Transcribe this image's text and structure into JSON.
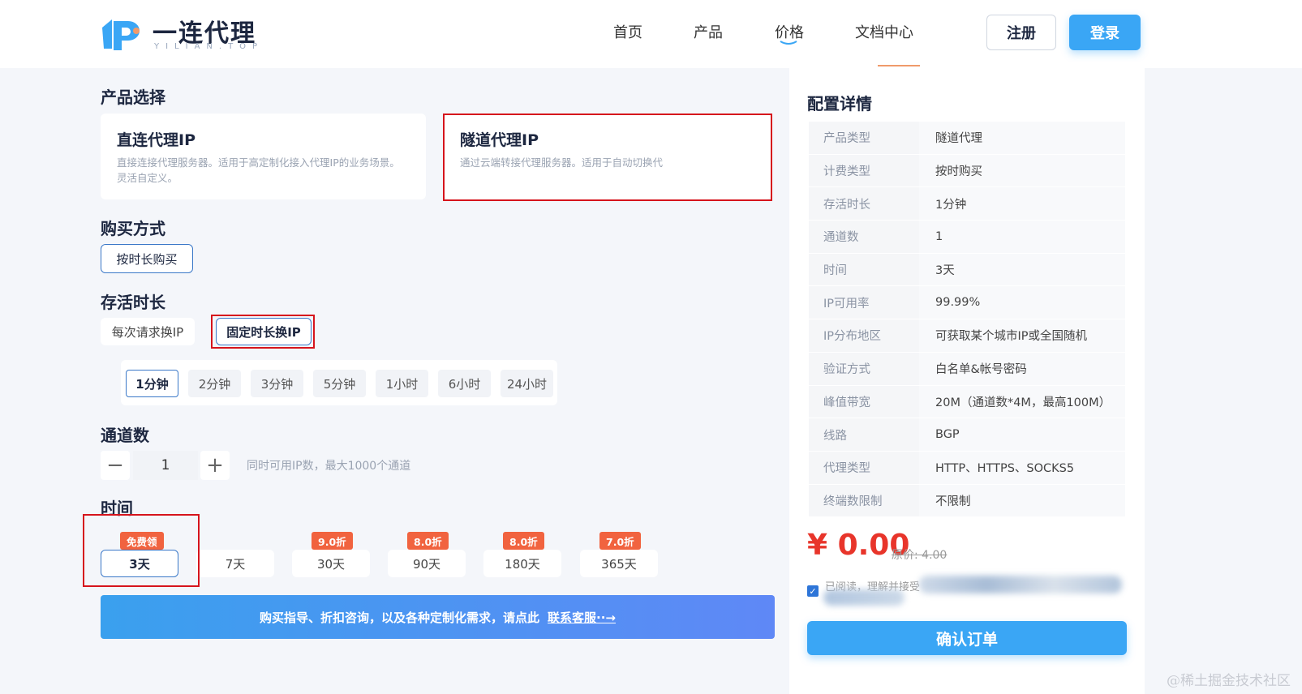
{
  "header": {
    "logo_text": "一连代理",
    "logo_sub": "YILIAN.TOP",
    "nav": [
      "首页",
      "产品",
      "价格",
      "文档中心"
    ],
    "register": "注册",
    "login": "登录"
  },
  "product": {
    "title": "产品选择",
    "cards": [
      {
        "name": "直连代理IP",
        "desc": "直接连接代理服务器。适用于高定制化接入代理IP的业务场景。灵活自定义。"
      },
      {
        "name": "隧道代理IP",
        "desc": "通过云端转接代理服务器。适用于自动切换代"
      }
    ]
  },
  "purchase": {
    "title": "购买方式",
    "option": "按时长购买"
  },
  "survival": {
    "title": "存活时长",
    "modes": [
      "每次请求换IP",
      "固定时长换IP"
    ],
    "durations": [
      "1分钟",
      "2分钟",
      "3分钟",
      "5分钟",
      "1小时",
      "6小时",
      "24小时"
    ]
  },
  "channels": {
    "title": "通道数",
    "minus": "−",
    "plus": "+",
    "value": "1",
    "hint": "同时可用IP数，最大1000个通道"
  },
  "time": {
    "title": "时间",
    "options": [
      {
        "label": "3天",
        "badge": "免费领"
      },
      {
        "label": "7天",
        "badge": ""
      },
      {
        "label": "30天",
        "badge": "9.0折"
      },
      {
        "label": "90天",
        "badge": "8.0折"
      },
      {
        "label": "180天",
        "badge": "8.0折"
      },
      {
        "label": "365天",
        "badge": "7.0折"
      }
    ]
  },
  "banner": {
    "text": "购买指导、折扣咨询，以及各种定制化需求，请点此",
    "link": "联系客服··→"
  },
  "config": {
    "title": "配置详情",
    "rows": [
      {
        "k": "产品类型",
        "v": "隧道代理"
      },
      {
        "k": "计费类型",
        "v": "按时购买"
      },
      {
        "k": "存活时长",
        "v": "1分钟"
      },
      {
        "k": "通道数",
        "v": "1"
      },
      {
        "k": "时间",
        "v": "3天"
      },
      {
        "k": "IP可用率",
        "v": "99.99%"
      },
      {
        "k": "IP分布地区",
        "v": "可获取某个城市IP或全国随机"
      },
      {
        "k": "验证方式",
        "v": "白名单&帐号密码"
      },
      {
        "k": "峰值带宽",
        "v": "20M（通道数*4M，最高100M）"
      },
      {
        "k": "线路",
        "v": "BGP"
      },
      {
        "k": "代理类型",
        "v": "HTTP、HTTPS、SOCKS5"
      },
      {
        "k": "终端数限制",
        "v": "不限制"
      }
    ],
    "price": "¥ 0.00",
    "orig_price": "原价: 4.00",
    "agree": "已阅读，理解并接受",
    "confirm": "确认订单"
  },
  "watermark": "@稀土掘金技术社区",
  "colors": {
    "accent": "#3aa6f5",
    "price": "#e8352b",
    "badge": "#f1633f",
    "highlight": "#d6141c"
  }
}
